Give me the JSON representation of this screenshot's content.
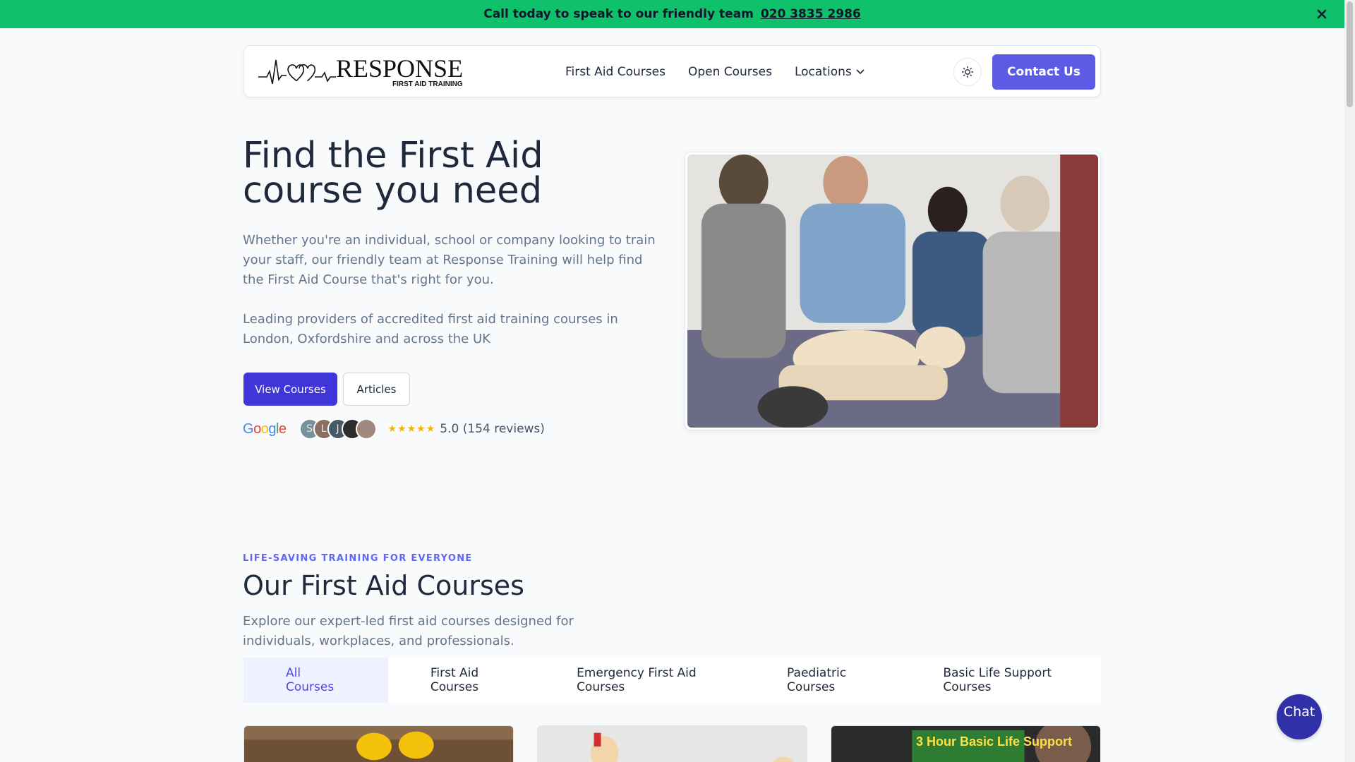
{
  "banner": {
    "text": "Call today to speak to our friendly team",
    "phone": "020 3835 2986",
    "close_icon": "close-icon"
  },
  "nav": {
    "logo_text": "RESPONSE",
    "logo_subtext": "FIRST AID TRAINING",
    "links": [
      "First Aid Courses",
      "Open Courses",
      "Locations"
    ],
    "theme_icon": "sun-icon",
    "contact_label": "Contact Us"
  },
  "hero": {
    "title": "Find the First Aid course you need",
    "paragraph1": "Whether you're an individual, school or company looking to train your staff, our friendly team at Response Training will help find the First Aid Course that's right for you.",
    "paragraph2": "Leading providers of accredited first aid training courses in London, Oxfordshire and across the UK",
    "primary_button": "View Courses",
    "secondary_button": "Articles",
    "reviews": {
      "provider": "Google",
      "avatars": [
        "S",
        "L",
        "J",
        "",
        ""
      ],
      "stars": "★★★★★",
      "rating_text": "5.0 (154 reviews)"
    }
  },
  "courses": {
    "eyebrow": "LIFE-SAVING TRAINING FOR EVERYONE",
    "title": "Our First Aid Courses",
    "description": "Explore our expert-led first aid courses designed for individuals, workplaces, and professionals.",
    "tabs": [
      "All Courses",
      "First Aid Courses",
      "Emergency First Aid Courses",
      "Paediatric Courses",
      "Basic Life Support Courses"
    ],
    "active_tab": "All Courses",
    "card3_overlay": "3 Hour Basic Life Support"
  },
  "chat": {
    "label": "Chat"
  },
  "colors": {
    "banner_bg": "#10c16c",
    "accent": "#5b5be6",
    "primary_button": "#3f35d9",
    "eyebrow": "#6366f1",
    "chat_bg": "#3030a8"
  }
}
